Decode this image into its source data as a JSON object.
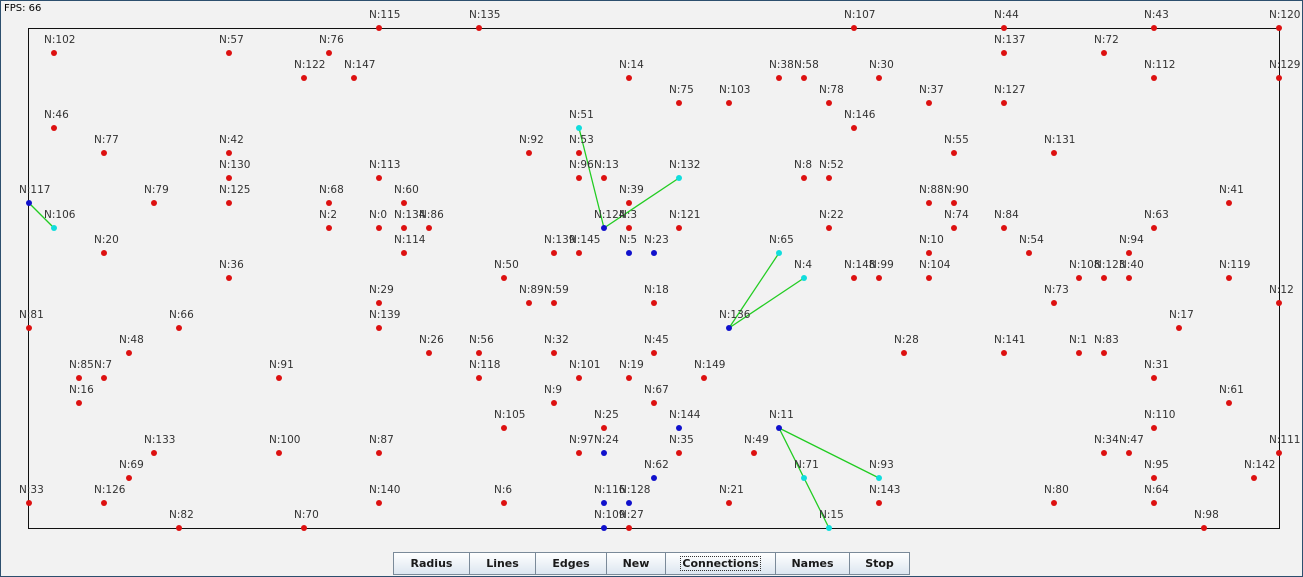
{
  "fps_label": "FPS: 66",
  "colors": {
    "node": "#dd1111",
    "connected": "#1111cc",
    "neighbor": "#11dddd",
    "line": "#22cc22",
    "boundary": "#111111"
  },
  "toolbar": {
    "buttons": [
      "Radius",
      "Lines",
      "Edges",
      "New",
      "Connections",
      "Names",
      "Stop"
    ],
    "focused": "Connections"
  }
}
